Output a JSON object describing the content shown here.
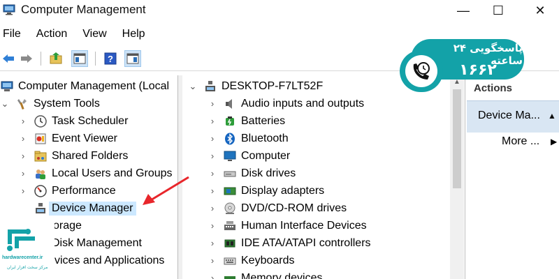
{
  "window": {
    "title": "Computer Management",
    "minimize_glyph": "—",
    "maximize_glyph": "☐",
    "close_glyph": "✕"
  },
  "menu": [
    "File",
    "Action",
    "View",
    "Help"
  ],
  "toolbar": {
    "icons": [
      "back-arrow-icon",
      "forward-arrow-icon",
      "up-folder-icon",
      "show-hide-tree-icon",
      "help-icon",
      "properties-icon"
    ]
  },
  "left_tree": {
    "root": "Computer Management (Local",
    "system_tools": "System Tools",
    "items": [
      {
        "label": "Task Scheduler",
        "icon": "clock-icon"
      },
      {
        "label": "Event Viewer",
        "icon": "event-viewer-icon"
      },
      {
        "label": "Shared Folders",
        "icon": "shared-folder-icon"
      },
      {
        "label": "Local Users and Groups",
        "icon": "users-icon"
      },
      {
        "label": "Performance",
        "icon": "performance-icon"
      },
      {
        "label": "Device Manager",
        "icon": "device-manager-icon"
      }
    ],
    "storage": "orage",
    "disk_management": "Disk Management",
    "services": "vices and Applications"
  },
  "center_tree": {
    "root": "DESKTOP-F7LT52F",
    "items": [
      {
        "label": "Audio inputs and outputs",
        "icon": "speaker-icon"
      },
      {
        "label": "Batteries",
        "icon": "battery-icon"
      },
      {
        "label": "Bluetooth",
        "icon": "bluetooth-icon"
      },
      {
        "label": "Computer",
        "icon": "monitor-icon"
      },
      {
        "label": "Disk drives",
        "icon": "disk-drive-icon"
      },
      {
        "label": "Display adapters",
        "icon": "display-adapter-icon"
      },
      {
        "label": "DVD/CD-ROM drives",
        "icon": "dvd-icon"
      },
      {
        "label": "Human Interface Devices",
        "icon": "hid-icon"
      },
      {
        "label": "IDE ATA/ATAPI controllers",
        "icon": "ide-controller-icon"
      },
      {
        "label": "Keyboards",
        "icon": "keyboard-icon"
      },
      {
        "label": "Memory devices",
        "icon": "memory-icon"
      }
    ]
  },
  "actions": {
    "header": "Actions",
    "section": "Device Ma...",
    "more": "More ..."
  },
  "badge": {
    "line1": "پاسخگویی ۲۴ ساعته",
    "line2": "۱۶۶۲",
    "bg_color": "#13a2a8"
  },
  "logo": {
    "site": "hardwarecenter.ir",
    "sub": "مرکز سخت افزار ایران"
  },
  "colors": {
    "selection": "#cce8ff",
    "accent": "#13a2a8",
    "arrow": "#e8262b"
  }
}
